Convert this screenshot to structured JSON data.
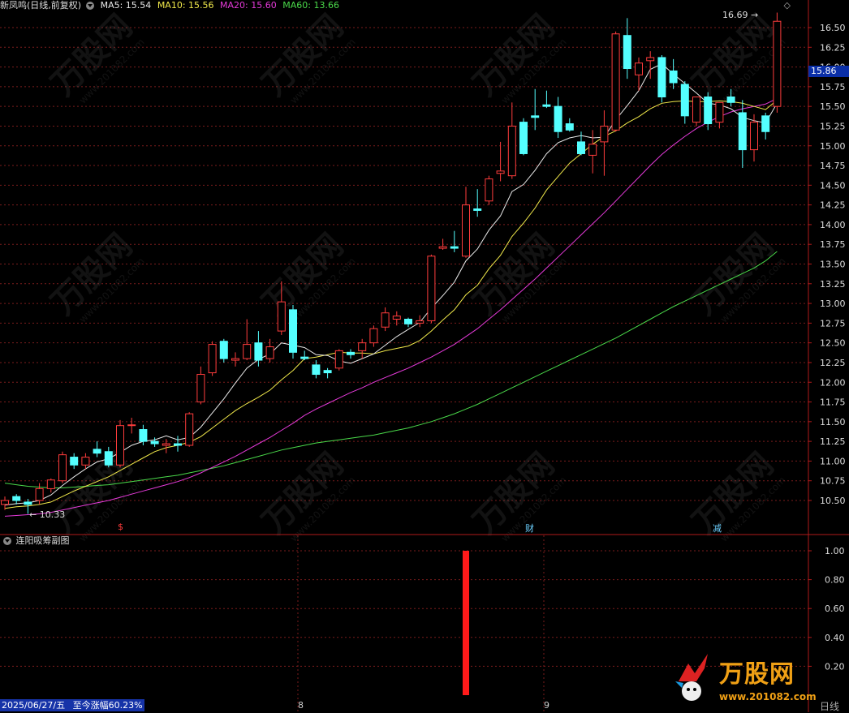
{
  "header": {
    "stock_label": "新凤鸣(日线,前复权)",
    "ma_items": [
      {
        "label": "MA5: 15.54",
        "color": "#e8e8e8"
      },
      {
        "label": "MA10: 15.56",
        "color": "#f0e84a"
      },
      {
        "label": "MA20: 15.60",
        "color": "#e53ad9"
      },
      {
        "label": "MA60: 13.66",
        "color": "#4ad94a"
      }
    ]
  },
  "price_axis": {
    "ticks": [
      "16.50",
      "16.25",
      "16.00",
      "15.75",
      "15.50",
      "15.25",
      "15.00",
      "14.75",
      "14.50",
      "14.25",
      "14.00",
      "13.75",
      "13.50",
      "13.25",
      "13.00",
      "12.75",
      "12.50",
      "12.25",
      "12.00",
      "11.75",
      "11.50",
      "11.25",
      "11.00",
      "10.75",
      "10.50"
    ],
    "current_price": "15.86"
  },
  "annotations": {
    "high_label": "16.69",
    "low_label": "10.33",
    "event_marks": [
      "$",
      "财",
      "减"
    ]
  },
  "sub_panel": {
    "title": "连阳吸筹副图",
    "ticks": [
      "1.00",
      "0.80",
      "0.60",
      "0.40",
      "0.20"
    ]
  },
  "status_bar": {
    "date_text": "2025/06/27/五",
    "gain_text": "至今涨幅60.23%"
  },
  "time_axis": {
    "labels": [
      "8",
      "9"
    ]
  },
  "bottom_right": {
    "label": "日线"
  },
  "watermark": {
    "brand": "万股网",
    "url": "www.201082.com"
  },
  "colors": {
    "up": "#ff3c3c",
    "down": "#54ffff",
    "grid": "#7a1c1c",
    "axis": "#b01a1a",
    "ma5": "#e8e8e8",
    "ma10": "#f0e84a",
    "ma20": "#e53ad9",
    "ma60": "#4ad94a",
    "signal": "#ff1a1a"
  },
  "chart_data": {
    "type": "candlestick",
    "candles": [
      {
        "o": 10.45,
        "h": 10.55,
        "l": 10.38,
        "c": 10.5
      },
      {
        "o": 10.55,
        "h": 10.58,
        "l": 10.45,
        "c": 10.5
      },
      {
        "o": 10.48,
        "h": 10.52,
        "l": 10.33,
        "c": 10.45
      },
      {
        "o": 10.5,
        "h": 10.72,
        "l": 10.45,
        "c": 10.65
      },
      {
        "o": 10.65,
        "h": 10.78,
        "l": 10.6,
        "c": 10.76
      },
      {
        "o": 10.75,
        "h": 11.12,
        "l": 10.72,
        "c": 11.08
      },
      {
        "o": 11.05,
        "h": 11.1,
        "l": 10.9,
        "c": 10.95
      },
      {
        "o": 10.95,
        "h": 11.1,
        "l": 10.9,
        "c": 11.05
      },
      {
        "o": 11.15,
        "h": 11.25,
        "l": 11.05,
        "c": 11.1
      },
      {
        "o": 11.12,
        "h": 11.18,
        "l": 10.92,
        "c": 10.95
      },
      {
        "o": 10.95,
        "h": 11.52,
        "l": 10.92,
        "c": 11.45
      },
      {
        "o": 11.45,
        "h": 11.55,
        "l": 11.35,
        "c": 11.46
      },
      {
        "o": 11.4,
        "h": 11.46,
        "l": 11.2,
        "c": 11.25
      },
      {
        "o": 11.25,
        "h": 11.3,
        "l": 11.18,
        "c": 11.22
      },
      {
        "o": 11.2,
        "h": 11.28,
        "l": 11.1,
        "c": 11.22
      },
      {
        "o": 11.22,
        "h": 11.32,
        "l": 11.12,
        "c": 11.2
      },
      {
        "o": 11.2,
        "h": 11.62,
        "l": 11.18,
        "c": 11.6
      },
      {
        "o": 11.75,
        "h": 12.2,
        "l": 11.72,
        "c": 12.1
      },
      {
        "o": 12.12,
        "h": 12.52,
        "l": 12.08,
        "c": 12.48
      },
      {
        "o": 12.52,
        "h": 12.55,
        "l": 12.25,
        "c": 12.3
      },
      {
        "o": 12.28,
        "h": 12.38,
        "l": 12.2,
        "c": 12.3
      },
      {
        "o": 12.3,
        "h": 12.8,
        "l": 12.28,
        "c": 12.48
      },
      {
        "o": 12.5,
        "h": 12.65,
        "l": 12.2,
        "c": 12.28
      },
      {
        "o": 12.3,
        "h": 12.55,
        "l": 12.25,
        "c": 12.45
      },
      {
        "o": 12.65,
        "h": 13.28,
        "l": 12.6,
        "c": 13.02
      },
      {
        "o": 12.92,
        "h": 12.98,
        "l": 12.3,
        "c": 12.38
      },
      {
        "o": 12.32,
        "h": 12.4,
        "l": 12.28,
        "c": 12.3
      },
      {
        "o": 12.22,
        "h": 12.28,
        "l": 12.05,
        "c": 12.1
      },
      {
        "o": 12.15,
        "h": 12.18,
        "l": 12.05,
        "c": 12.12
      },
      {
        "o": 12.18,
        "h": 12.42,
        "l": 12.15,
        "c": 12.4
      },
      {
        "o": 12.38,
        "h": 12.42,
        "l": 12.3,
        "c": 12.35
      },
      {
        "o": 12.4,
        "h": 12.55,
        "l": 12.3,
        "c": 12.5
      },
      {
        "o": 12.5,
        "h": 12.72,
        "l": 12.45,
        "c": 12.68
      },
      {
        "o": 12.7,
        "h": 12.95,
        "l": 12.65,
        "c": 12.88
      },
      {
        "o": 12.8,
        "h": 12.9,
        "l": 12.72,
        "c": 12.84
      },
      {
        "o": 12.8,
        "h": 12.82,
        "l": 12.7,
        "c": 12.74
      },
      {
        "o": 12.75,
        "h": 12.85,
        "l": 12.7,
        "c": 12.78
      },
      {
        "o": 12.78,
        "h": 13.62,
        "l": 12.75,
        "c": 13.6
      },
      {
        "o": 13.7,
        "h": 13.82,
        "l": 13.68,
        "c": 13.72
      },
      {
        "o": 13.72,
        "h": 13.92,
        "l": 13.65,
        "c": 13.7
      },
      {
        "o": 13.6,
        "h": 14.48,
        "l": 13.58,
        "c": 14.25
      },
      {
        "o": 14.2,
        "h": 14.45,
        "l": 14.1,
        "c": 14.18
      },
      {
        "o": 14.3,
        "h": 14.62,
        "l": 14.25,
        "c": 14.58
      },
      {
        "o": 14.65,
        "h": 15.05,
        "l": 14.55,
        "c": 14.68
      },
      {
        "o": 14.62,
        "h": 15.55,
        "l": 14.58,
        "c": 15.25
      },
      {
        "o": 15.3,
        "h": 15.35,
        "l": 14.88,
        "c": 14.9
      },
      {
        "o": 15.38,
        "h": 15.72,
        "l": 15.2,
        "c": 15.36
      },
      {
        "o": 15.52,
        "h": 15.7,
        "l": 15.48,
        "c": 15.5
      },
      {
        "o": 15.5,
        "h": 15.62,
        "l": 15.1,
        "c": 15.18
      },
      {
        "o": 15.28,
        "h": 15.35,
        "l": 15.18,
        "c": 15.2
      },
      {
        "o": 15.05,
        "h": 15.18,
        "l": 14.88,
        "c": 14.9
      },
      {
        "o": 14.88,
        "h": 15.2,
        "l": 14.65,
        "c": 15.02
      },
      {
        "o": 15.05,
        "h": 15.45,
        "l": 14.62,
        "c": 15.25
      },
      {
        "o": 15.2,
        "h": 16.45,
        "l": 15.18,
        "c": 16.42
      },
      {
        "o": 16.4,
        "h": 16.62,
        "l": 15.85,
        "c": 15.98
      },
      {
        "o": 15.9,
        "h": 16.12,
        "l": 15.7,
        "c": 16.05
      },
      {
        "o": 16.08,
        "h": 16.2,
        "l": 15.85,
        "c": 16.12
      },
      {
        "o": 16.12,
        "h": 16.15,
        "l": 15.55,
        "c": 15.62
      },
      {
        "o": 15.95,
        "h": 16.1,
        "l": 15.72,
        "c": 15.8
      },
      {
        "o": 15.78,
        "h": 15.82,
        "l": 15.28,
        "c": 15.38
      },
      {
        "o": 15.3,
        "h": 15.62,
        "l": 15.25,
        "c": 15.62
      },
      {
        "o": 15.62,
        "h": 15.68,
        "l": 15.2,
        "c": 15.28
      },
      {
        "o": 15.3,
        "h": 15.55,
        "l": 15.22,
        "c": 15.55
      },
      {
        "o": 15.62,
        "h": 15.72,
        "l": 15.5,
        "c": 15.55
      },
      {
        "o": 15.42,
        "h": 15.58,
        "l": 14.72,
        "c": 14.95
      },
      {
        "o": 14.95,
        "h": 15.4,
        "l": 14.8,
        "c": 15.3
      },
      {
        "o": 15.38,
        "h": 15.42,
        "l": 15.08,
        "c": 15.18
      },
      {
        "o": 15.5,
        "h": 16.69,
        "l": 15.42,
        "c": 16.58
      }
    ],
    "ma5": [
      10.44,
      10.46,
      10.47,
      10.5,
      10.57,
      10.69,
      10.8,
      10.9,
      10.99,
      11.03,
      11.11,
      11.2,
      11.25,
      11.27,
      11.32,
      11.27,
      11.3,
      11.43,
      11.61,
      11.79,
      11.99,
      12.18,
      12.29,
      12.36,
      12.5,
      12.47,
      12.44,
      12.35,
      12.34,
      12.27,
      12.24,
      12.3,
      12.36,
      12.47,
      12.58,
      12.67,
      12.76,
      12.94,
      13.1,
      13.27,
      13.54,
      13.69,
      13.93,
      14.11,
      14.42,
      14.51,
      14.69,
      14.9,
      15.04,
      15.1,
      15.13,
      15.1,
      15.11,
      15.33,
      15.51,
      15.7,
      15.97,
      16.04,
      15.91,
      15.79,
      15.67,
      15.54,
      15.52,
      15.47,
      15.36,
      15.32,
      15.29,
      15.54
    ],
    "ma10": [
      10.4,
      10.42,
      10.43,
      10.45,
      10.48,
      10.55,
      10.62,
      10.68,
      10.74,
      10.8,
      10.88,
      10.96,
      11.04,
      11.12,
      11.17,
      11.2,
      11.24,
      11.31,
      11.42,
      11.53,
      11.64,
      11.73,
      11.81,
      11.9,
      12.03,
      12.15,
      12.3,
      12.32,
      12.35,
      12.38,
      12.37,
      12.37,
      12.36,
      12.4,
      12.43,
      12.46,
      12.53,
      12.65,
      12.79,
      12.92,
      13.11,
      13.23,
      13.44,
      13.61,
      13.85,
      14.02,
      14.21,
      14.44,
      14.61,
      14.78,
      14.9,
      15.02,
      15.12,
      15.19,
      15.29,
      15.37,
      15.47,
      15.54,
      15.56,
      15.57,
      15.56,
      15.56,
      15.57,
      15.56,
      15.54,
      15.5,
      15.46,
      15.58
    ],
    "ma20": [
      10.3,
      10.31,
      10.32,
      10.33,
      10.35,
      10.38,
      10.41,
      10.44,
      10.47,
      10.5,
      10.54,
      10.58,
      10.62,
      10.66,
      10.7,
      10.74,
      10.79,
      10.85,
      10.92,
      10.99,
      11.06,
      11.14,
      11.22,
      11.3,
      11.39,
      11.48,
      11.58,
      11.66,
      11.73,
      11.8,
      11.87,
      11.93,
      12.0,
      12.06,
      12.12,
      12.18,
      12.25,
      12.32,
      12.4,
      12.48,
      12.58,
      12.68,
      12.8,
      12.92,
      13.05,
      13.18,
      13.31,
      13.45,
      13.59,
      13.73,
      13.87,
      14.01,
      14.15,
      14.3,
      14.45,
      14.6,
      14.75,
      14.89,
      15.01,
      15.12,
      15.22,
      15.3,
      15.37,
      15.43,
      15.47,
      15.5,
      15.53,
      15.6
    ],
    "ma60": [
      10.72,
      10.7,
      10.68,
      10.67,
      10.66,
      10.66,
      10.67,
      10.68,
      10.69,
      10.7,
      10.72,
      10.74,
      10.76,
      10.78,
      10.8,
      10.82,
      10.85,
      10.88,
      10.91,
      10.94,
      10.98,
      11.02,
      11.06,
      11.1,
      11.14,
      11.17,
      11.2,
      11.23,
      11.25,
      11.27,
      11.29,
      11.31,
      11.33,
      11.36,
      11.39,
      11.42,
      11.46,
      11.5,
      11.55,
      11.6,
      11.66,
      11.72,
      11.79,
      11.86,
      11.93,
      12.0,
      12.07,
      12.14,
      12.21,
      12.28,
      12.35,
      12.42,
      12.49,
      12.56,
      12.64,
      12.72,
      12.8,
      12.88,
      12.96,
      13.03,
      13.1,
      13.17,
      13.24,
      13.31,
      13.38,
      13.45,
      13.54,
      13.66
    ],
    "signal": [
      0,
      0,
      0,
      0,
      0,
      0,
      0,
      0,
      0,
      0,
      0,
      0,
      0,
      0,
      0,
      0,
      0,
      0,
      0,
      0,
      0,
      0,
      0,
      0,
      0,
      0,
      0,
      0,
      0,
      0,
      0,
      0,
      0,
      0,
      0,
      0,
      0,
      0,
      0,
      0,
      1,
      0,
      0,
      0,
      0,
      0,
      0,
      0,
      0,
      0,
      0,
      0,
      0,
      0,
      0,
      0,
      0,
      0,
      0,
      0,
      0,
      0,
      0,
      0,
      0,
      0,
      0,
      0
    ],
    "ylim": [
      10.35,
      16.65
    ],
    "sub_ylim": [
      0,
      1.05
    ]
  }
}
